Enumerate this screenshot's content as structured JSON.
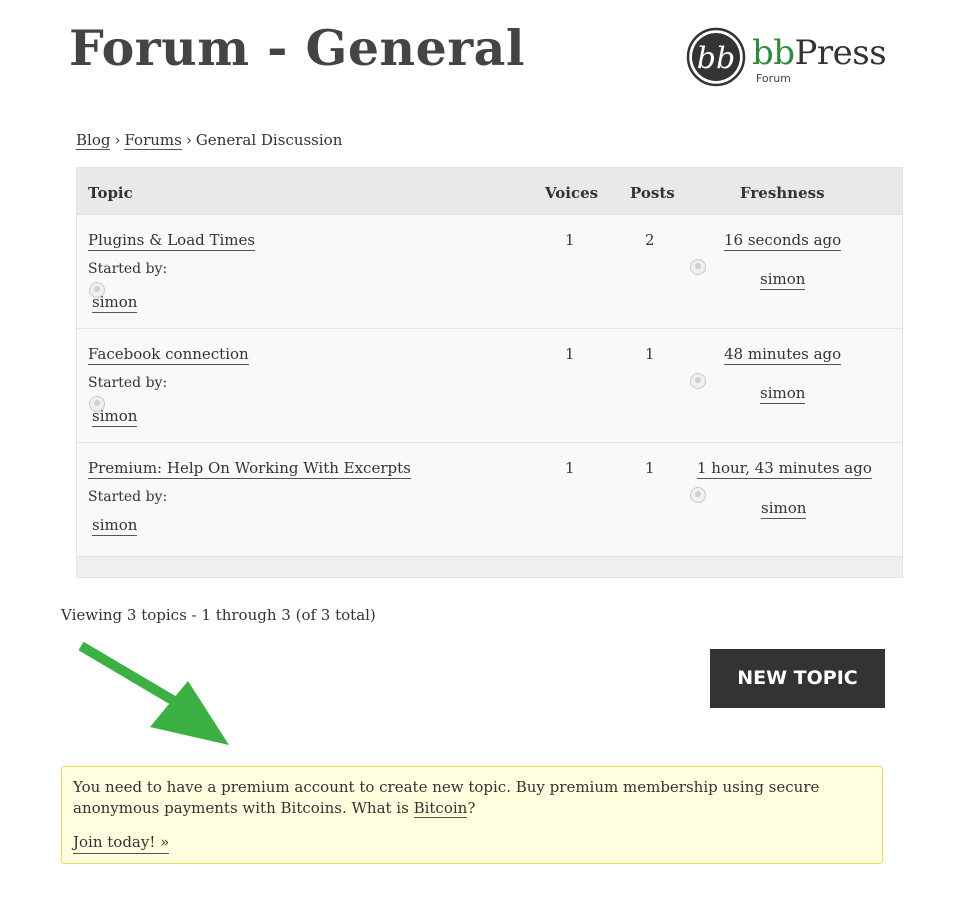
{
  "page": {
    "title": "Forum - General"
  },
  "logo": {
    "bb": "bb",
    "press": "Press",
    "sub": "Forum"
  },
  "breadcrumb": {
    "items": [
      "Blog",
      "Forums",
      "General Discussion"
    ],
    "separator": "›"
  },
  "table": {
    "headers": {
      "topic": "Topic",
      "voices": "Voices",
      "posts": "Posts",
      "freshness": "Freshness"
    },
    "rows": [
      {
        "title": "Plugins & Load Times",
        "started_by_label": "Started by:",
        "author": "simon",
        "voices": "1",
        "posts": "2",
        "freshness": "16 seconds ago",
        "last_author": "simon"
      },
      {
        "title": "Facebook connection",
        "started_by_label": "Started by:",
        "author": "simon",
        "voices": "1",
        "posts": "1",
        "freshness": "48 minutes ago",
        "last_author": "simon"
      },
      {
        "title": "Premium: Help On Working With Excerpts",
        "started_by_label": "Started by:",
        "author": "simon",
        "voices": "1",
        "posts": "1",
        "freshness": "1 hour, 43 minutes ago",
        "last_author": "simon"
      }
    ]
  },
  "pagination": {
    "viewing_text": "Viewing 3 topics - 1 through 3 (of 3 total)"
  },
  "actions": {
    "new_topic_label": "NEW TOPIC"
  },
  "notice": {
    "text_before": "You need to have a premium account to create new topic. Buy premium membership using secure anonymous payments with Bitcoins. What is ",
    "bitcoin_link": "Bitcoin",
    "text_after": "?",
    "join_link": "Join today! »"
  },
  "colors": {
    "arrow": "#3cb043",
    "notice_bg": "#ffffe0",
    "notice_border": "#e6db55",
    "button_bg": "#333333",
    "logo_green": "#2e8b3a"
  },
  "icons": {
    "arrow": "green-arrow-icon",
    "avatar": "avatar-icon",
    "logo_mark": "bbpress-logo-icon"
  }
}
